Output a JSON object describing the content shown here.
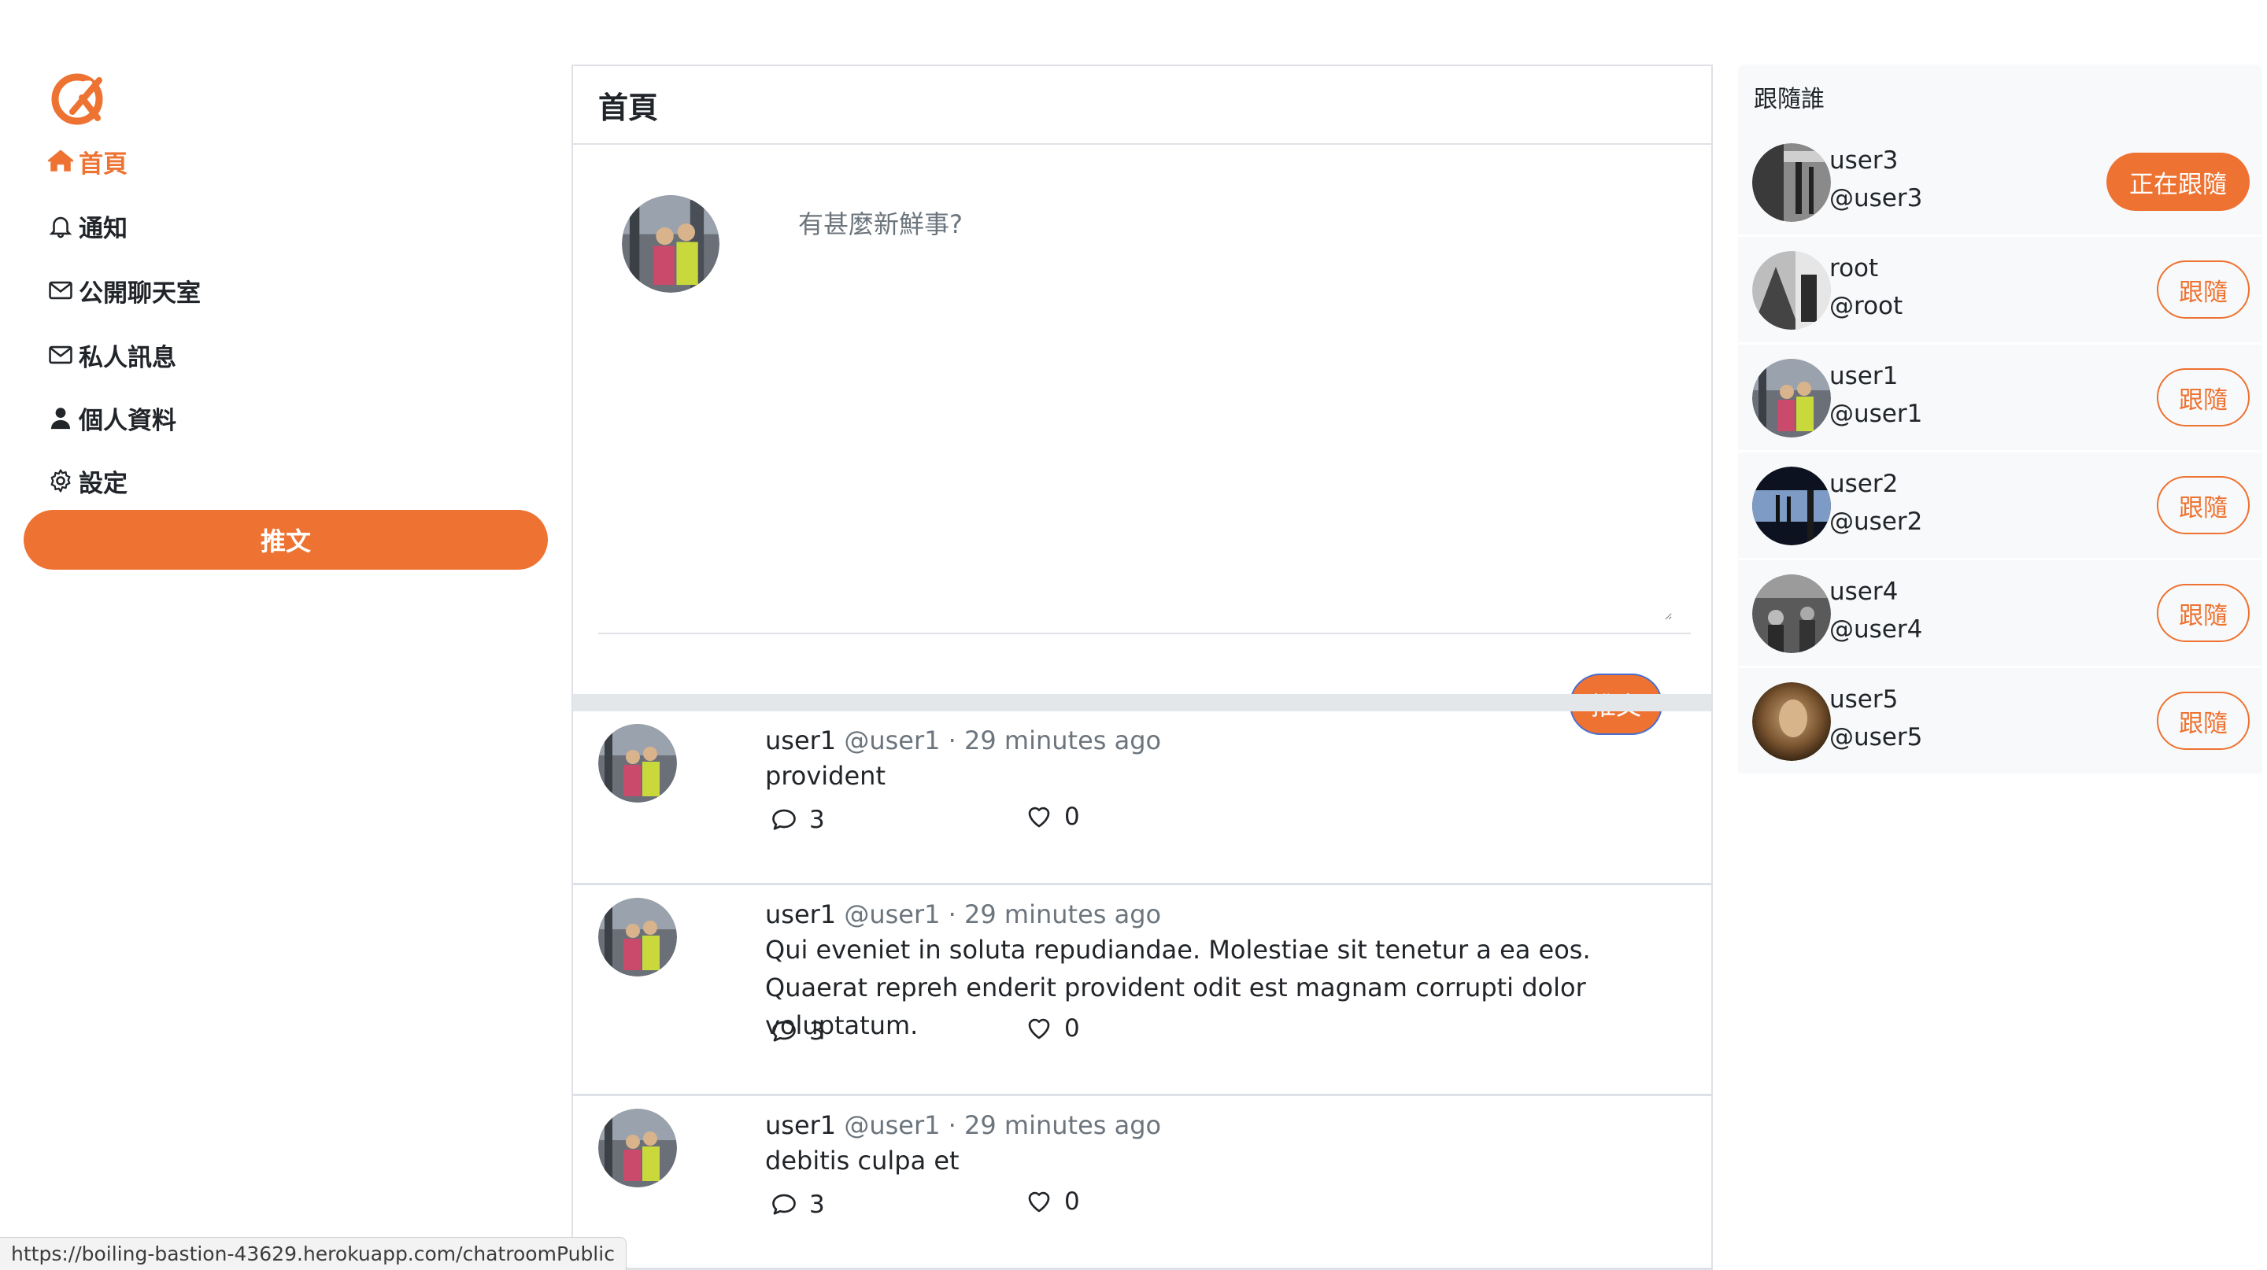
{
  "nav": {
    "items": [
      {
        "label": "首頁",
        "icon": "home-icon",
        "active": true
      },
      {
        "label": "通知",
        "icon": "bell-icon",
        "active": false
      },
      {
        "label": "公開聊天室",
        "icon": "envelope-icon",
        "active": false
      },
      {
        "label": "私人訊息",
        "icon": "envelope-icon",
        "active": false
      },
      {
        "label": "個人資料",
        "icon": "user-icon",
        "active": false
      },
      {
        "label": "設定",
        "icon": "gear-icon",
        "active": false
      }
    ],
    "tweet_button": "推文"
  },
  "main": {
    "title": "首頁",
    "composer": {
      "placeholder": "有甚麼新鮮事?",
      "submit_label": "推文"
    },
    "tweets": [
      {
        "name": "user1",
        "handle": "@user1",
        "time": "· 29 minutes ago",
        "body": "provident",
        "replies": "3",
        "likes": "0"
      },
      {
        "name": "user1",
        "handle": "@user1",
        "time": "· 29 minutes ago",
        "body": "Qui eveniet in soluta repudiandae. Molestiae sit tenetur a ea eos. Quaerat repreh enderit provident odit est magnam corrupti dolor voluptatum.",
        "replies": "3",
        "likes": "0"
      },
      {
        "name": "user1",
        "handle": "@user1",
        "time": "· 29 minutes ago",
        "body": "debitis culpa et",
        "replies": "3",
        "likes": "0"
      }
    ]
  },
  "who_to_follow": {
    "title": "跟隨誰",
    "users": [
      {
        "name": "user3",
        "handle": "@user3",
        "button": "正在跟隨",
        "following": true
      },
      {
        "name": "root",
        "handle": "@root",
        "button": "跟隨",
        "following": false
      },
      {
        "name": "user1",
        "handle": "@user1",
        "button": "跟隨",
        "following": false
      },
      {
        "name": "user2",
        "handle": "@user2",
        "button": "跟隨",
        "following": false
      },
      {
        "name": "user4",
        "handle": "@user4",
        "button": "跟隨",
        "following": false
      },
      {
        "name": "user5",
        "handle": "@user5",
        "button": "跟隨",
        "following": false
      }
    ]
  },
  "status_bar": {
    "url": "https://boiling-bastion-43629.herokuapp.com/chatroomPublic"
  },
  "colors": {
    "brand": "#ee7231",
    "muted": "#6c757d",
    "border": "#dee2e6",
    "panel": "#f8f9fa"
  }
}
